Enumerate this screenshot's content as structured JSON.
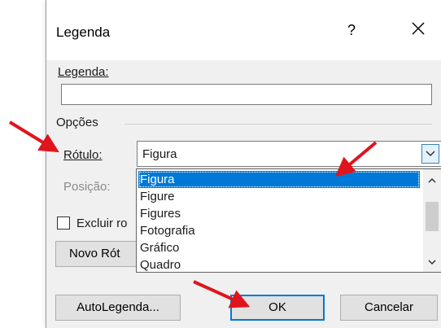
{
  "dialog": {
    "title": "Legenda",
    "help": "?",
    "caption_label": "Legenda:",
    "caption_value": "",
    "options_group": "Opções",
    "label_label": "Rótulo:",
    "label_value": "Figura",
    "position_label": "Posição:",
    "exclude_label": "Excluir ro",
    "new_label_button": "Novo Rót",
    "dropdown_options": [
      "Figura",
      "Figure",
      "Figures",
      "Fotografia",
      "Gráfico",
      "Quadro"
    ],
    "selected_option": "Figura",
    "autocaption_button": "AutoLegenda...",
    "ok_button": "OK",
    "cancel_button": "Cancelar"
  },
  "colors": {
    "selection": "#0078d7",
    "annotation_arrow": "#e0141c"
  }
}
